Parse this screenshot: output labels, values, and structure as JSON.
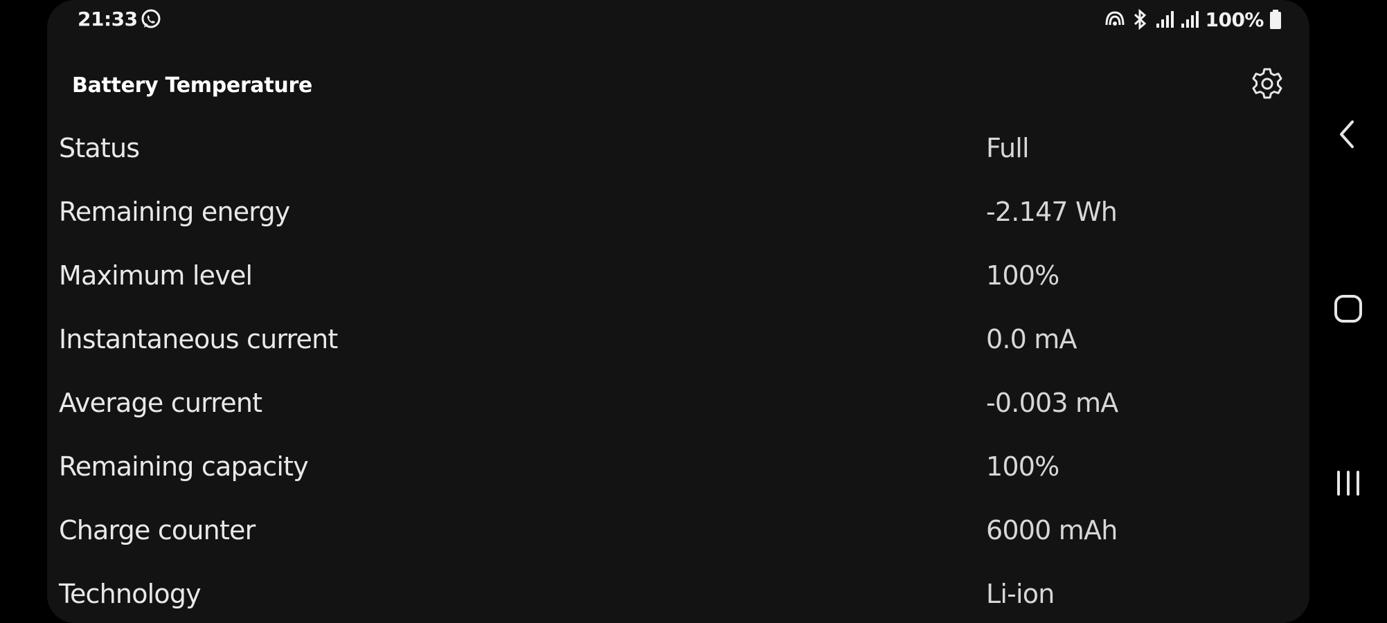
{
  "status_bar": {
    "time": "21:33",
    "battery_percent": "100%",
    "icons": [
      "whatsapp-icon",
      "nfc-icon",
      "bluetooth-icon",
      "signal-icon",
      "signal-icon",
      "battery-icon"
    ]
  },
  "app": {
    "title": "Battery Temperature",
    "settings_icon": "gear-icon"
  },
  "info_rows": [
    {
      "label": "Status",
      "value": "Full"
    },
    {
      "label": "Remaining energy",
      "value": "-2.147 Wh"
    },
    {
      "label": "Maximum level",
      "value": "100%"
    },
    {
      "label": "Instantaneous current",
      "value": "0.0 mA"
    },
    {
      "label": "Average current",
      "value": "-0.003 mA"
    },
    {
      "label": "Remaining capacity",
      "value": "100%"
    },
    {
      "label": "Charge counter",
      "value": "6000 mAh"
    },
    {
      "label": "Technology",
      "value": "Li-ion"
    }
  ],
  "nav_bar": {
    "buttons": [
      "back-icon",
      "home-icon",
      "recents-icon"
    ]
  },
  "colors": {
    "background": "#131313",
    "outer": "#000000",
    "text_primary": "#e9e9e9",
    "text_value": "#d7d7d7"
  }
}
